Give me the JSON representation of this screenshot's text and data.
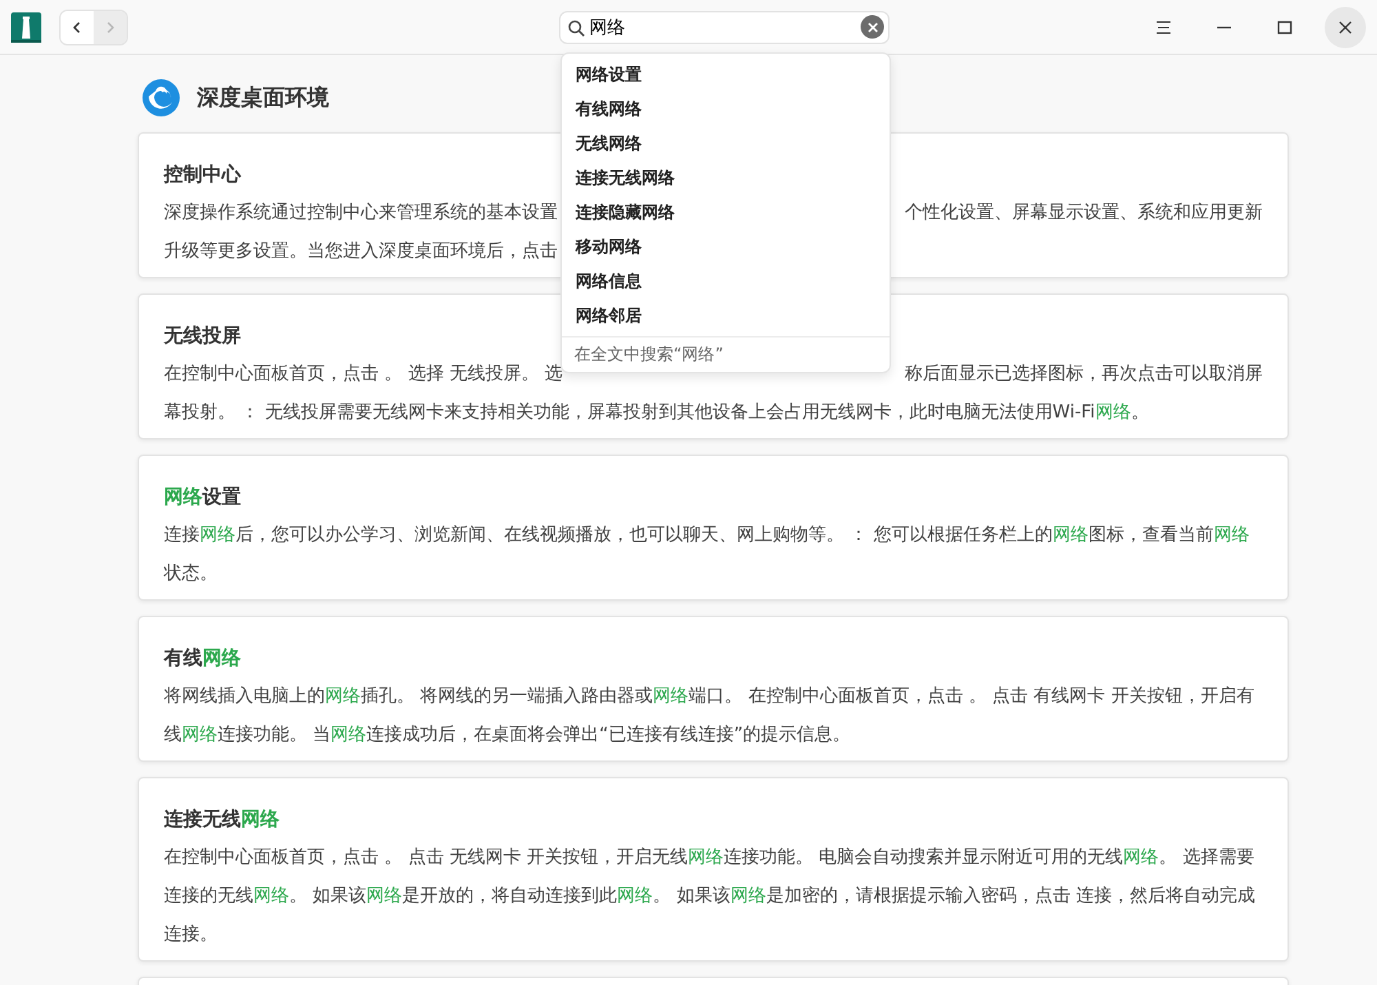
{
  "toolbar": {
    "back": {
      "disabled": false
    },
    "forward": {
      "disabled": true
    }
  },
  "search": {
    "value": "网络"
  },
  "suggestions": [
    {
      "label": "网络设置"
    },
    {
      "label": "有线网络"
    },
    {
      "label": "无线网络"
    },
    {
      "label": "连接无线网络"
    },
    {
      "label": "连接隐藏网络"
    },
    {
      "label": "移动网络"
    },
    {
      "label": "网络信息"
    },
    {
      "label": "网络邻居"
    }
  ],
  "search_all": "在全文中搜索“网络”",
  "header": {
    "title": "深度桌面环境"
  },
  "cards": [
    {
      "kind": "lines",
      "title": [
        {
          "text": "控制中心",
          "match": false
        }
      ],
      "lines": [
        [
          [
            {
              "text": "深度操作系统通过控制中心来管理系统的基本设置",
              "match": false
            }
          ],
          [
            {
              "text": "个性化设置、屏幕显示设置、系统和应用更新",
              "match": false
            }
          ]
        ],
        [
          [
            {
              "text": "升级等更多设置。当您进入深度桌面环境后，点击",
              "match": false
            }
          ]
        ]
      ]
    },
    {
      "kind": "lines",
      "title": [
        {
          "text": "无线投屏",
          "match": false
        }
      ],
      "lines": [
        [
          [
            {
              "text": "在控制中心面板首页，点击 。 选择 无线投屏。 选",
              "match": false
            }
          ],
          [
            {
              "text": "称后面显示已选择图标，再次点击可以取消屏",
              "match": false
            }
          ]
        ],
        [
          [
            {
              "text": "幕投射。 ： 无线投屏需要无线网卡来支持相关功能，屏幕投射到其他设备上会占用无线网卡，此时电脑无法使用Wi-Fi",
              "match": false
            },
            {
              "text": "网络",
              "match": true
            },
            {
              "text": "。",
              "match": false
            }
          ]
        ]
      ]
    },
    {
      "kind": "text",
      "title": [
        {
          "text": "网络",
          "match": true
        },
        {
          "text": "设置",
          "match": false
        }
      ],
      "body": [
        {
          "text": "连接",
          "match": false
        },
        {
          "text": "网络",
          "match": true
        },
        {
          "text": "后，您可以办公学习、浏览新闻、在线视频播放，也可以聊天、网上购物等。 ： 您可以根据任务栏上的",
          "match": false
        },
        {
          "text": "网络",
          "match": true
        },
        {
          "text": "图标，查看当前",
          "match": false
        },
        {
          "text": "网络",
          "match": true
        },
        {
          "text": "状态。",
          "match": false
        }
      ]
    },
    {
      "kind": "text",
      "title": [
        {
          "text": "有线",
          "match": false
        },
        {
          "text": "网络",
          "match": true
        }
      ],
      "body": [
        {
          "text": "将网线插入电脑上的",
          "match": false
        },
        {
          "text": "网络",
          "match": true
        },
        {
          "text": "插孔。 将网线的另一端插入路由器或",
          "match": false
        },
        {
          "text": "网络",
          "match": true
        },
        {
          "text": "端口。 在控制中心面板首页，点击 。 点击 有线网卡 开关按钮，开启有线",
          "match": false
        },
        {
          "text": "网络",
          "match": true
        },
        {
          "text": "连接功能。 当",
          "match": false
        },
        {
          "text": "网络",
          "match": true
        },
        {
          "text": "连接成功后，在桌面将会弹出“已连接有线连接”的提示信息。",
          "match": false
        }
      ]
    },
    {
      "kind": "text",
      "title": [
        {
          "text": "连接无线",
          "match": false
        },
        {
          "text": "网络",
          "match": true
        }
      ],
      "body": [
        {
          "text": "在控制中心面板首页，点击 。 点击 无线网卡 开关按钮，开启无线",
          "match": false
        },
        {
          "text": "网络",
          "match": true
        },
        {
          "text": "连接功能。 电脑会自动搜索并显示附近可用的无线",
          "match": false
        },
        {
          "text": "网络",
          "match": true
        },
        {
          "text": "。 选择需要连接的无线",
          "match": false
        },
        {
          "text": "网络",
          "match": true
        },
        {
          "text": "。 如果该",
          "match": false
        },
        {
          "text": "网络",
          "match": true
        },
        {
          "text": "是开放的，将自动连接到此",
          "match": false
        },
        {
          "text": "网络",
          "match": true
        },
        {
          "text": "。 如果该",
          "match": false
        },
        {
          "text": "网络",
          "match": true
        },
        {
          "text": "是加密的，请根据提示输入密码，点击 连接，然后将自动完成连接。",
          "match": false
        }
      ]
    },
    {
      "kind": "empty"
    }
  ]
}
